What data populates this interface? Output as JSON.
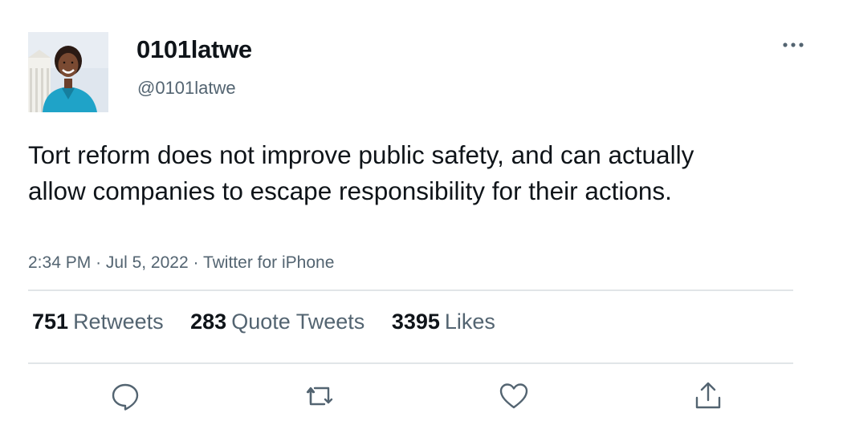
{
  "user": {
    "display_name": "0101latwe",
    "handle": "@0101latwe"
  },
  "tweet": {
    "text": "Tort reform does not improve public safety, and can actually allow companies to escape responsibility for their actions.",
    "time": "2:34 PM",
    "date": "Jul 5, 2022",
    "source": "Twitter for iPhone",
    "separator": "·"
  },
  "stats": {
    "retweets": {
      "count": "751",
      "label": "Retweets"
    },
    "quotes": {
      "count": "283",
      "label": "Quote Tweets"
    },
    "likes": {
      "count": "3395",
      "label": "Likes"
    }
  },
  "actions": [
    "reply-icon",
    "retweet-icon",
    "like-icon",
    "share-icon"
  ],
  "colors": {
    "text_primary": "#0f1419",
    "text_secondary": "#536471",
    "icon": "#536471",
    "divider": "#e1e5e8"
  }
}
